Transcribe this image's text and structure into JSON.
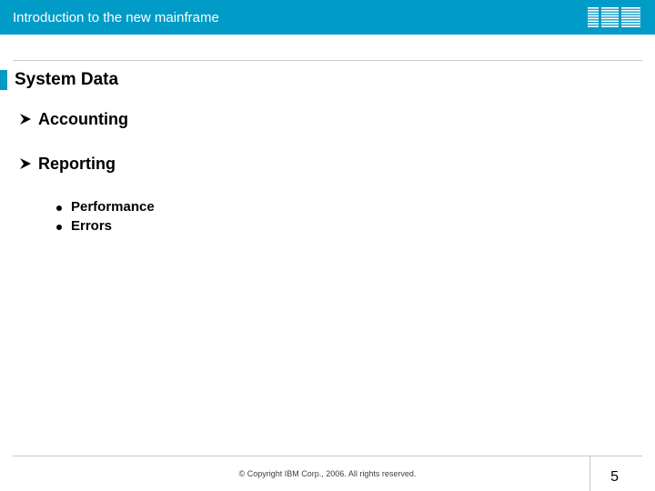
{
  "header": {
    "title": "Introduction to the new mainframe",
    "logo_name": "ibm-logo"
  },
  "slide": {
    "title": "System Data",
    "bullets": [
      {
        "label": "Accounting",
        "sub": []
      },
      {
        "label": "Reporting",
        "sub": [
          {
            "label": "Performance"
          },
          {
            "label": "Errors"
          }
        ]
      }
    ]
  },
  "footer": {
    "copyright": "© Copyright IBM Corp., 2006. All rights reserved.",
    "page": "5"
  },
  "colors": {
    "accent": "#009bc7"
  }
}
